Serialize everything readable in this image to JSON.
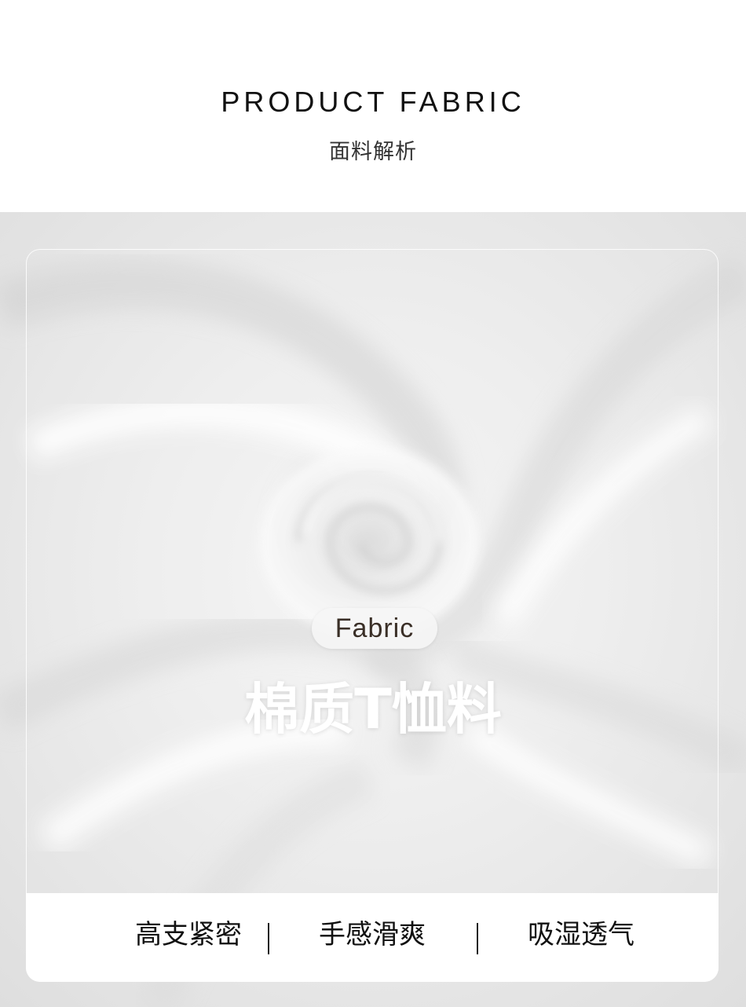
{
  "header": {
    "title": "PRODUCT FABRIC",
    "subtitle": "面料解析"
  },
  "card": {
    "badge": "Fabric",
    "title": "棉质T恤料",
    "features": [
      "高支紧密",
      "手感滑爽",
      "吸湿透气"
    ]
  },
  "colors": {
    "background": "#ffffff",
    "fabric": "#ececec",
    "badge_text": "#3a2f27",
    "title_text": "#ffffff"
  }
}
